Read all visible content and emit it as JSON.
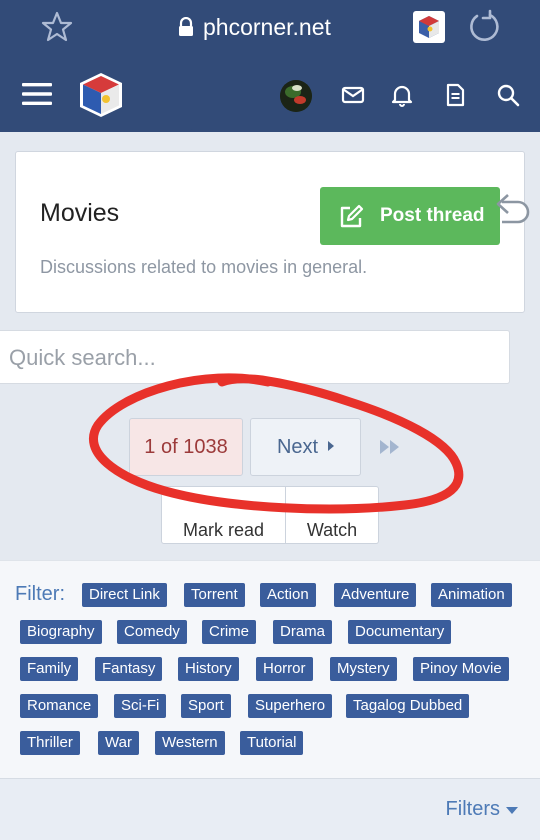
{
  "browser": {
    "url": "phcorner.net"
  },
  "forum": {
    "title": "Movies",
    "description": "Discussions related to movies in general.",
    "post_thread_label": "Post thread"
  },
  "search": {
    "placeholder": "Quick search..."
  },
  "pagination": {
    "current": "1 of 1038",
    "next_label": "Next"
  },
  "actions": {
    "mark_read_label": "Mark read",
    "watch_label": "Watch"
  },
  "filter": {
    "label": "Filter:",
    "tags": [
      "Direct Link",
      "Torrent",
      "Action",
      "Adventure",
      "Animation",
      "Biography",
      "Comedy",
      "Crime",
      "Drama",
      "Documentary",
      "Family",
      "Fantasy",
      "History",
      "Horror",
      "Mystery",
      "Pinoy Movie",
      "Romance",
      "Sci-Fi",
      "Sport",
      "Superhero",
      "Tagalog Dubbed",
      "Thriller",
      "War",
      "Western",
      "Tutorial"
    ],
    "bottom_label": "Filters"
  },
  "colors": {
    "header": "#324b78",
    "post_button": "#5cb85c",
    "tag": "#3a5d9c",
    "annotation": "#e8312a"
  },
  "icons": [
    "star-icon",
    "lock-icon",
    "extension-icon",
    "reload-icon",
    "menu-icon",
    "logo",
    "avatar",
    "mail-icon",
    "bell-icon",
    "document-icon",
    "search-icon",
    "edit-icon",
    "back-arrow-icon",
    "last-page-icon",
    "caret-down-icon"
  ]
}
